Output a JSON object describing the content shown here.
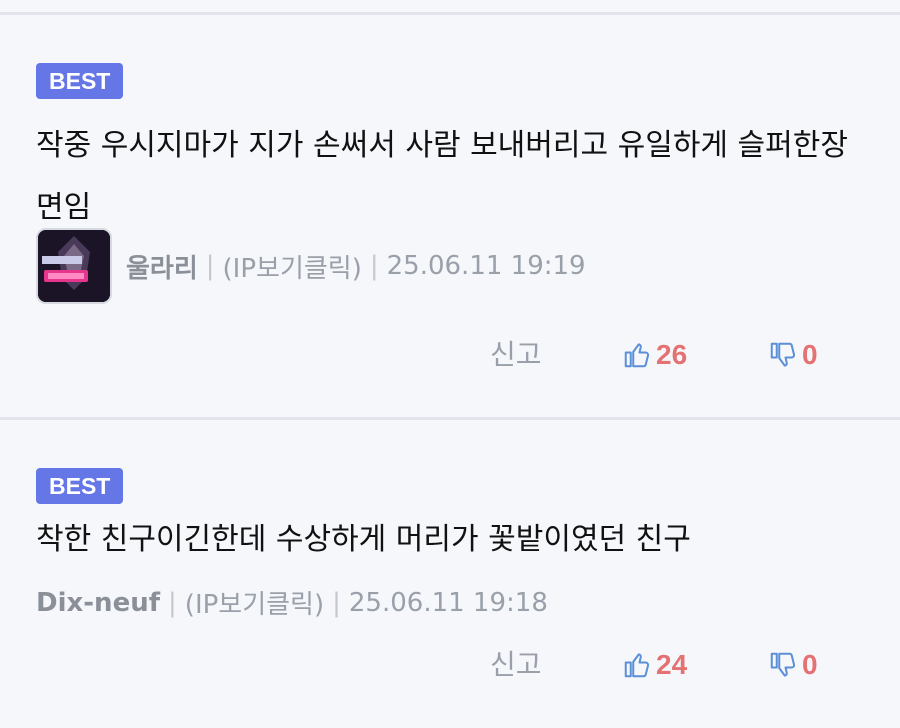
{
  "comments": [
    {
      "badge": "BEST",
      "text": "작중 우시지마가 지가 손써서 사람 보내버리고 유일하게 슬퍼한장면임",
      "nickname": "울라리",
      "ip_label": "(IP보기클릭)",
      "datetime": "25.06.11 19:19",
      "has_avatar": true,
      "report_label": "신고",
      "likes": "26",
      "dislikes": "0",
      "like_icon": "thumbs-up-icon",
      "dislike_icon": "thumbs-down-icon"
    },
    {
      "badge": "BEST",
      "text": "착한 친구이긴한데 수상하게 머리가 꽃밭이였던 친구",
      "nickname": "Dix-neuf",
      "ip_label": "(IP보기클릭)",
      "datetime": "25.06.11 19:18",
      "has_avatar": false,
      "report_label": "신고",
      "likes": "24",
      "dislikes": "0",
      "like_icon": "thumbs-up-icon",
      "dislike_icon": "thumbs-down-icon"
    }
  ],
  "colors": {
    "badge_bg": "#6577e6",
    "like_count": "#e47272",
    "icon_blue": "#5b8fd6",
    "background": "#f5f7fb"
  }
}
